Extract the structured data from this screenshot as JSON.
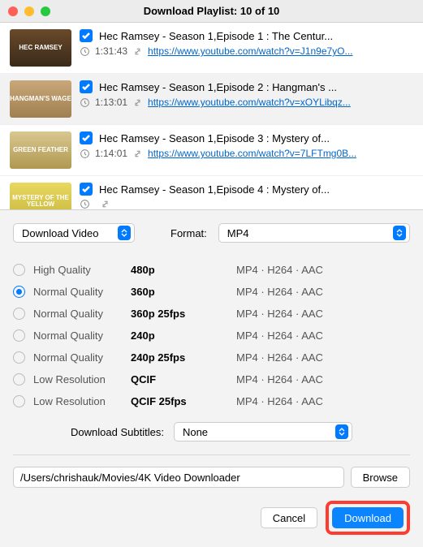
{
  "window": {
    "title": "Download Playlist: 10 of 10"
  },
  "playlist": [
    {
      "thumb_label": "HEC RAMSEY",
      "title": "Hec Ramsey - Season 1,Episode 1 : The Centur...",
      "duration": "1:31:43",
      "url": "https://www.youtube.com/watch?v=J1n9e7yO...",
      "selected": false
    },
    {
      "thumb_label": "HANGMAN'S WAGE",
      "title": "Hec Ramsey - Season 1,Episode 2 : Hangman's ...",
      "duration": "1:13:01",
      "url": "https://www.youtube.com/watch?v=xOYLibqz...",
      "selected": true
    },
    {
      "thumb_label": "GREEN FEATHER",
      "title": "Hec Ramsey - Season 1,Episode 3 : Mystery of...",
      "duration": "1:14:01",
      "url": "https://www.youtube.com/watch?v=7LFTmg0B...",
      "selected": false
    },
    {
      "thumb_label": "MYSTERY OF THE YELLOW",
      "title": "Hec Ramsey - Season 1,Episode 4 : Mystery of...",
      "duration": "",
      "url": "",
      "selected": false
    }
  ],
  "controls": {
    "download_mode": "Download Video",
    "format_label": "Format:",
    "format_value": "MP4"
  },
  "qualities": [
    {
      "label": "High Quality",
      "res": "480p",
      "fmt": "MP4 · H264 · AAC",
      "checked": false
    },
    {
      "label": "Normal Quality",
      "res": "360p",
      "fmt": "MP4 · H264 · AAC",
      "checked": true
    },
    {
      "label": "Normal Quality",
      "res": "360p 25fps",
      "fmt": "MP4 · H264 · AAC",
      "checked": false
    },
    {
      "label": "Normal Quality",
      "res": "240p",
      "fmt": "MP4 · H264 · AAC",
      "checked": false
    },
    {
      "label": "Normal Quality",
      "res": "240p 25fps",
      "fmt": "MP4 · H264 · AAC",
      "checked": false
    },
    {
      "label": "Low Resolution",
      "res": "QCIF",
      "fmt": "MP4 · H264 · AAC",
      "checked": false
    },
    {
      "label": "Low Resolution",
      "res": "QCIF 25fps",
      "fmt": "MP4 · H264 · AAC",
      "checked": false
    }
  ],
  "subtitles": {
    "label": "Download Subtitles:",
    "value": "None"
  },
  "path": "/Users/chrishauk/Movies/4K Video Downloader",
  "buttons": {
    "browse": "Browse",
    "cancel": "Cancel",
    "download": "Download"
  }
}
